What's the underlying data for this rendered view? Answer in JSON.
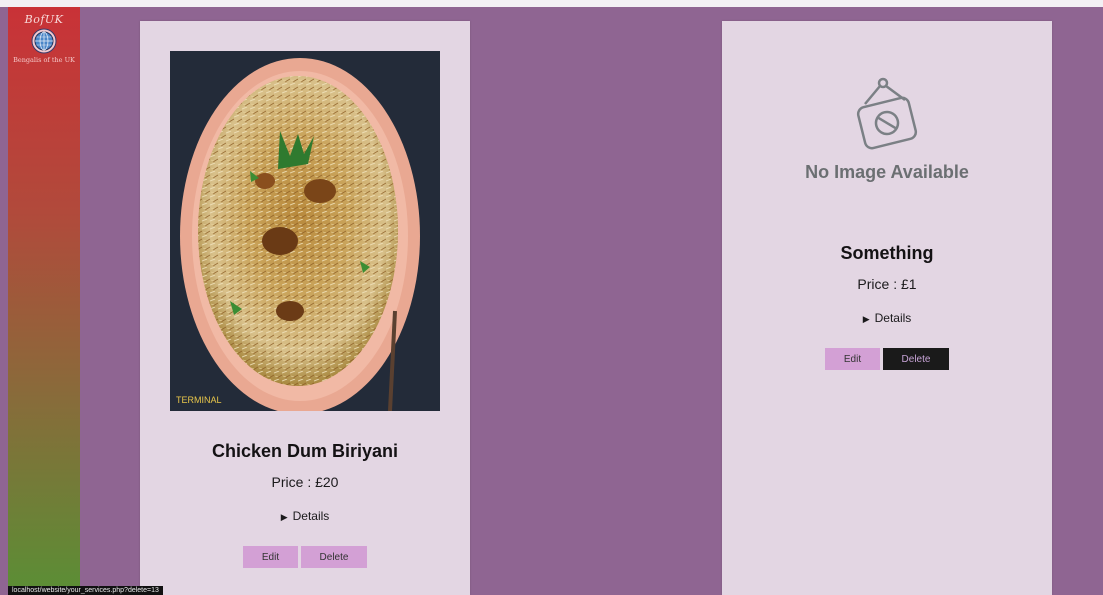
{
  "sidebar": {
    "logo_title": "BofUK",
    "logo_subtitle": "Bengalis of the UK",
    "logo_icon": "globe-icon"
  },
  "services": [
    {
      "title": "Chicken Dum Biriyani",
      "price": "Price : £20",
      "details_label": "Details",
      "edit_label": "Edit",
      "delete_label": "Delete",
      "image_watermark": "TERMINAL"
    },
    {
      "title": "Something",
      "price": "Price : £1",
      "details_label": "Details",
      "edit_label": "Edit",
      "delete_label": "Delete",
      "placeholder_text": "No Image Available"
    }
  ],
  "status_bar": {
    "url": "localhost/website/your_services.php?delete=13"
  },
  "colors": {
    "background": "#8f6592",
    "card": "#e3d6e3",
    "button_light": "#d3a0d5",
    "button_dark": "#1a1a1a"
  }
}
